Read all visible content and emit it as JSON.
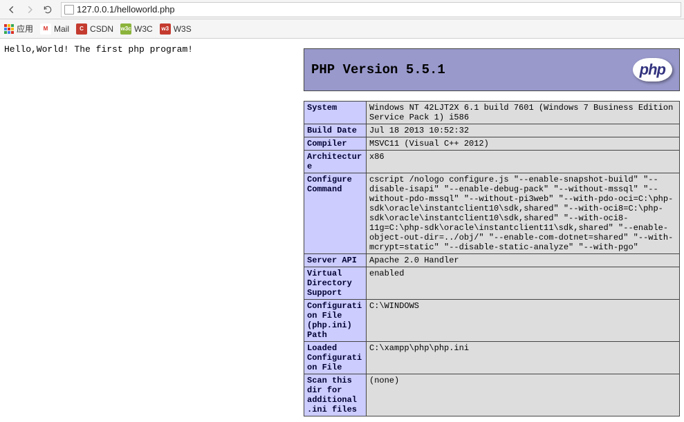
{
  "nav": {
    "url": "127.0.0.1/helloworld.php"
  },
  "bookmarks": {
    "apps_label": "应用",
    "items": [
      {
        "label": "Mail",
        "icon_bg": "#fff",
        "icon_letter": "M",
        "icon_color": "#d93025"
      },
      {
        "label": "CSDN",
        "icon_bg": "#c43b2f",
        "icon_letter": "C",
        "icon_color": "#fff"
      },
      {
        "label": "W3C",
        "icon_bg": "#8bb33b",
        "icon_letter": "w3c",
        "icon_color": "#fff"
      },
      {
        "label": "W3S",
        "icon_bg": "#c43b2f",
        "icon_letter": "w3",
        "icon_color": "#fff"
      }
    ]
  },
  "page": {
    "hello": "Hello,World! The first php program!"
  },
  "php": {
    "title": "PHP Version 5.5.1",
    "logo_text": "php",
    "rows": [
      {
        "k": "System",
        "v": "Windows NT 42LJT2X 6.1 build 7601 (Windows 7 Business Edition Service Pack 1) i586"
      },
      {
        "k": "Build Date",
        "v": "Jul 18 2013 10:52:32"
      },
      {
        "k": "Compiler",
        "v": "MSVC11 (Visual C++ 2012)"
      },
      {
        "k": "Architecture",
        "v": "x86"
      },
      {
        "k": "Configure Command",
        "v": "cscript /nologo configure.js \"--enable-snapshot-build\" \"--disable-isapi\" \"--enable-debug-pack\" \"--without-mssql\" \"--without-pdo-mssql\" \"--without-pi3web\" \"--with-pdo-oci=C:\\php-sdk\\oracle\\instantclient10\\sdk,shared\" \"--with-oci8=C:\\php-sdk\\oracle\\instantclient10\\sdk,shared\" \"--with-oci8-11g=C:\\php-sdk\\oracle\\instantclient11\\sdk,shared\" \"--enable-object-out-dir=../obj/\" \"--enable-com-dotnet=shared\" \"--with-mcrypt=static\" \"--disable-static-analyze\" \"--with-pgo\""
      },
      {
        "k": "Server API",
        "v": "Apache 2.0 Handler"
      },
      {
        "k": "Virtual Directory Support",
        "v": "enabled"
      },
      {
        "k": "Configuration File (php.ini) Path",
        "v": "C:\\WINDOWS"
      },
      {
        "k": "Loaded Configuration File",
        "v": "C:\\xampp\\php\\php.ini"
      },
      {
        "k": "Scan this dir for additional .ini files",
        "v": "(none)"
      }
    ]
  }
}
